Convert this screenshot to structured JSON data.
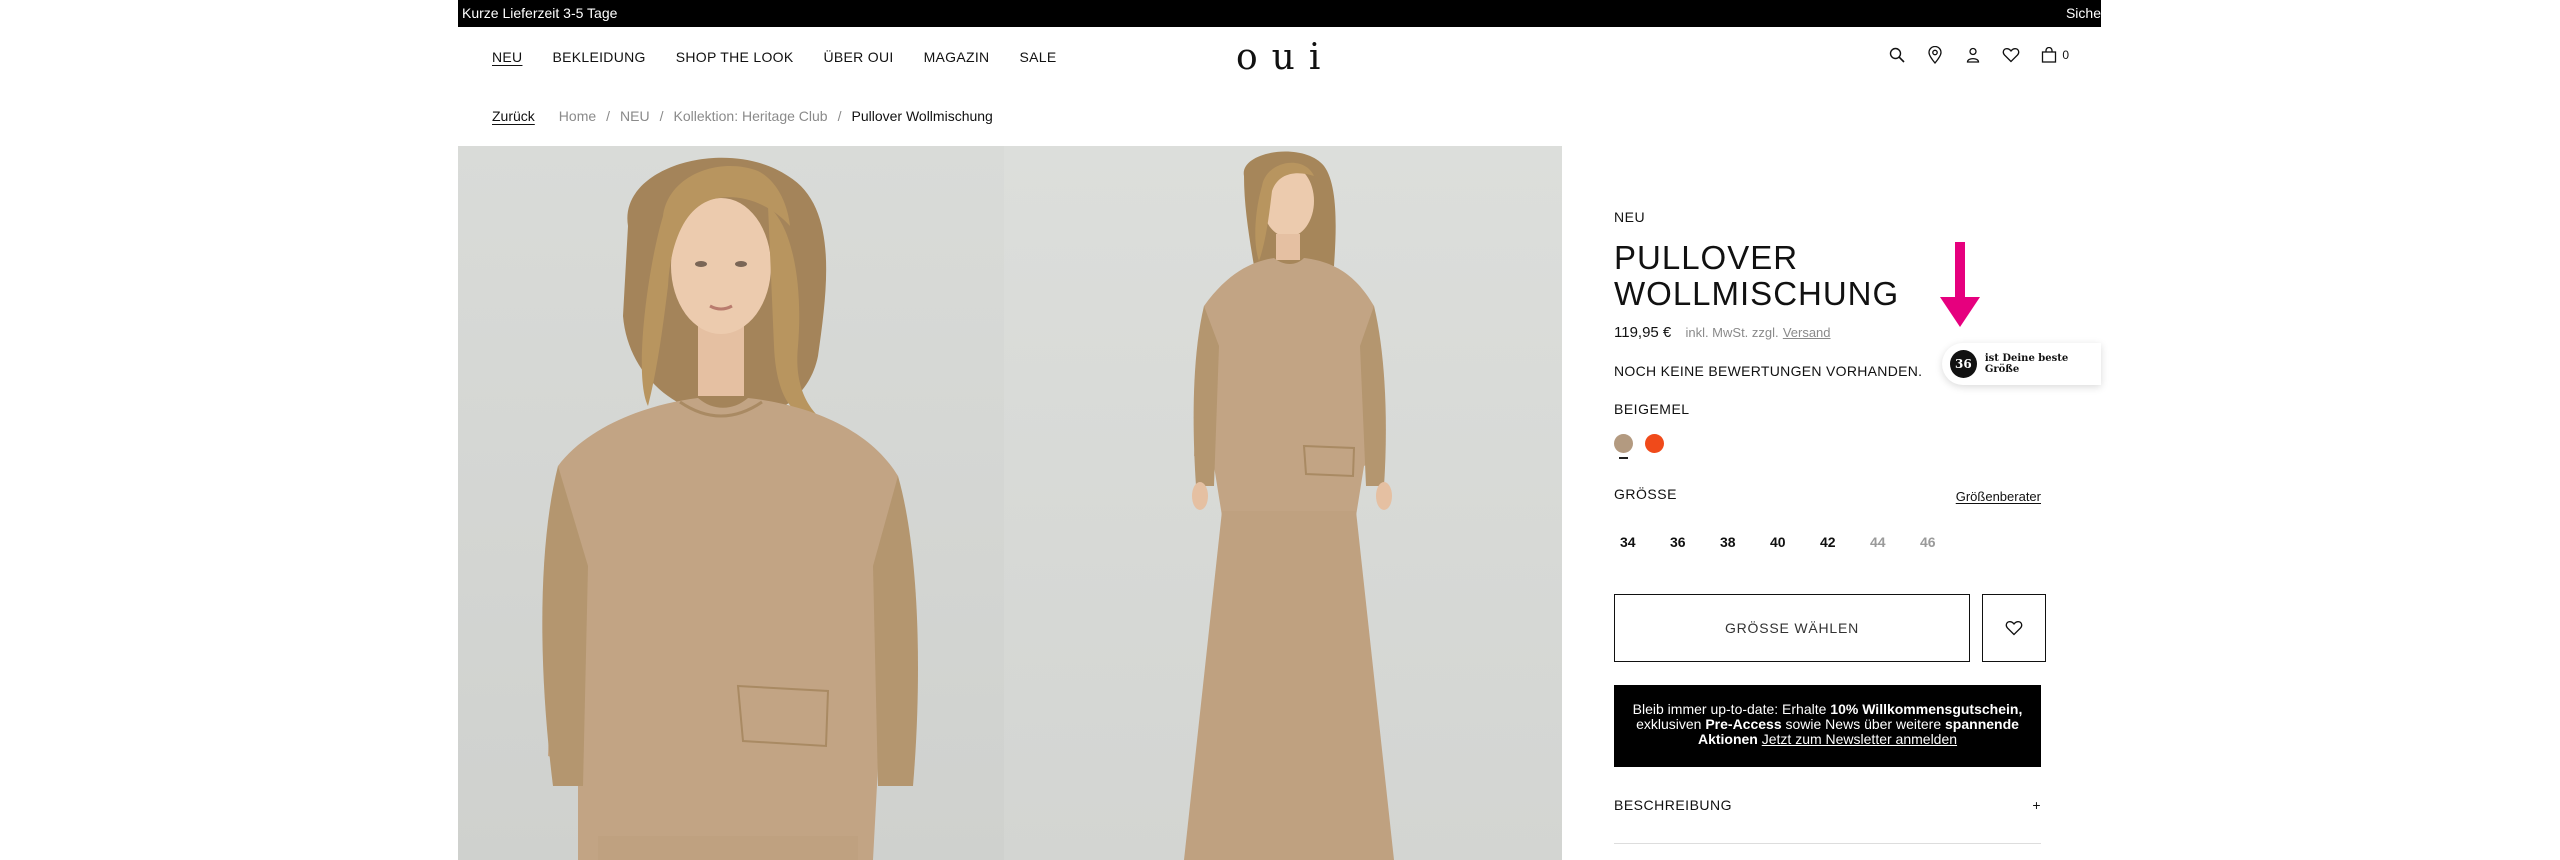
{
  "topbar": {
    "left": "Kurze Lieferzeit 3-5 Tage",
    "right": "Siche"
  },
  "nav": [
    "NEU",
    "BEKLEIDUNG",
    "SHOP THE LOOK",
    "ÜBER OUI",
    "MAGAZIN",
    "SALE"
  ],
  "logo": "oui",
  "header_icons": {
    "cart_count": "0",
    "names": [
      "search-icon",
      "location-icon",
      "account-icon",
      "heart-icon",
      "bag-icon"
    ]
  },
  "breadcrumb": {
    "back": "Zurück",
    "items": [
      "Home",
      "NEU",
      "Kollektion: Heritage Club"
    ],
    "current": "Pullover Wollmischung"
  },
  "product": {
    "tag": "NEU",
    "title": "PULLOVER WOLLMISCHUNG",
    "price": "119,95 €",
    "tax_note": "inkl. MwSt. zzgl.",
    "shipping_link": "Versand",
    "reviews": "NOCH KEINE BEWERTUNGEN VORHANDEN.",
    "color_name": "BEIGEMEL",
    "colors": [
      "#b39a80",
      "#f04a1a"
    ],
    "size_label": "GRÖSSE",
    "size_advisor": "Größenberater",
    "sizes": [
      {
        "label": "34",
        "available": true
      },
      {
        "label": "36",
        "available": true
      },
      {
        "label": "38",
        "available": true
      },
      {
        "label": "40",
        "available": true
      },
      {
        "label": "42",
        "available": true
      },
      {
        "label": "44",
        "available": false
      },
      {
        "label": "46",
        "available": false
      }
    ],
    "choose_size_button": "GRÖSSE WÄHLEN"
  },
  "newsletter": {
    "t1": "Bleib immer up-to-date: Erhalte ",
    "b1": "10% Willkommensgutschein,",
    "t2": "exklusiven ",
    "b2": "Pre-Access",
    "t3": " sowie News über weitere ",
    "b3": "spannende Aktionen",
    "link": "Jetzt zum Newsletter anmelden"
  },
  "accordion": {
    "label": "BESCHREIBUNG",
    "toggle": "+"
  },
  "fit_widget": {
    "size": "36",
    "text": "ist Deine beste Größe",
    "arrow_color": "#e6007e"
  },
  "colors": {
    "accent": "#e6007e",
    "sweater": "#c2a484"
  }
}
